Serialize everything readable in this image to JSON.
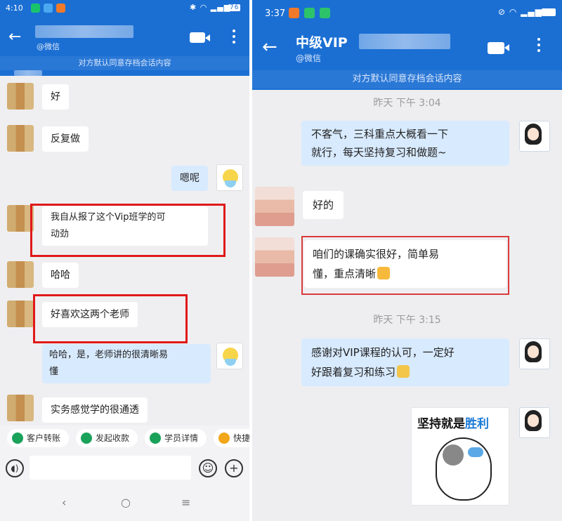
{
  "left": {
    "status": {
      "time": "4:10",
      "battery": "76"
    },
    "header": {
      "subtitle": "@微信"
    },
    "notice": "对方默认同意存档会话内容",
    "messages": [
      {
        "from": "other",
        "text": "好"
      },
      {
        "from": "other",
        "text": "反复做"
      },
      {
        "from": "me",
        "text": "嗯呢"
      },
      {
        "from": "other",
        "line1": "我自从报了这个Vip班学的可",
        "line2": "动劲"
      },
      {
        "from": "other",
        "text": "哈哈"
      },
      {
        "from": "other",
        "text": "好喜欢这两个老师"
      },
      {
        "from": "me",
        "line1": "哈哈，是，老师讲的很清晰易",
        "line2": "懂"
      },
      {
        "from": "other",
        "text": "实务感觉学的很通透"
      }
    ],
    "quick_actions": [
      "客户转账",
      "发起收款",
      "学员详情",
      "快捷"
    ],
    "nav": {
      "back": "‹",
      "home": "○",
      "menu": "≡"
    }
  },
  "right": {
    "status": {
      "time": "3:37"
    },
    "header": {
      "title": "中级VIP",
      "subtitle": "@微信"
    },
    "notice": "对方默认同意存档会话内容",
    "timestamp1": "昨天  下午 3:04",
    "timestamp2": "昨天  下午 3:15",
    "messages": [
      {
        "from": "me",
        "line1": "不客气，三科重点大概看一下",
        "line2": "就行，每天坚持复习和做题~"
      },
      {
        "from": "other",
        "text": "好的"
      },
      {
        "from": "other",
        "line1": "咱们的课确实很好，简单易",
        "line2": "懂，重点清晰"
      },
      {
        "from": "me",
        "line1": "感谢对VIP课程的认可，一定好",
        "line2": "好跟着复习和练习"
      }
    ],
    "sticker": {
      "text_a": "坚持就是",
      "text_b": "胜利"
    }
  },
  "colors": {
    "header_blue": "#1b6fd3",
    "highlight_red": "#e01919",
    "my_bubble": "#d8eafe"
  }
}
